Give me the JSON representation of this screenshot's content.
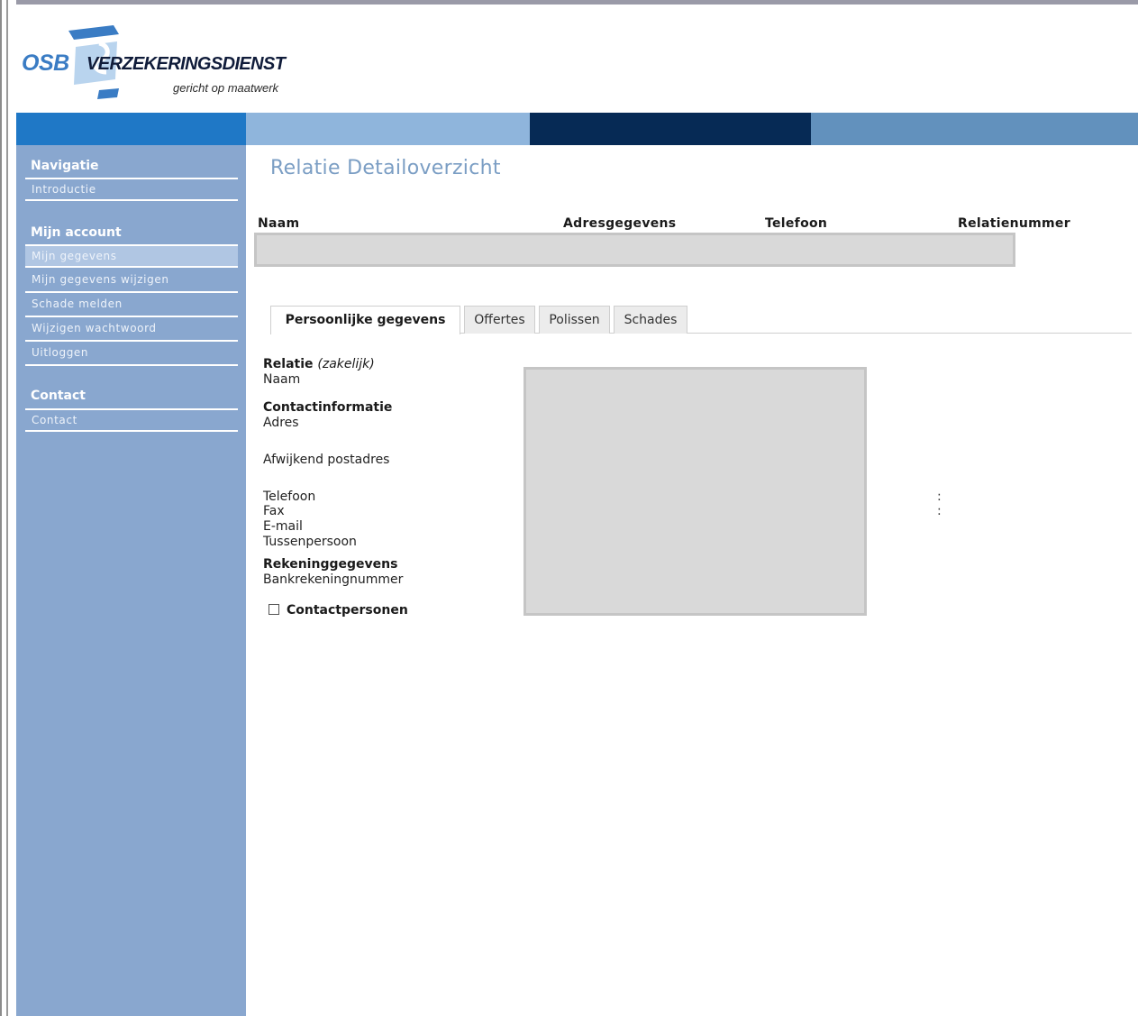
{
  "logo": {
    "osb": "OSB",
    "brand": "VERZEKERINGSDIENST",
    "tagline": "gericht op maatwerk"
  },
  "colors": {
    "band_blue": "#1f78c6",
    "band_light": "#8fb5dc",
    "band_navy": "#062a55",
    "band_mid": "#6291bd",
    "sidebar": "#89a7cf",
    "title": "#7b9ec4"
  },
  "sidebar": {
    "sections": [
      {
        "heading": "Navigatie",
        "items": [
          "Introductie"
        ]
      },
      {
        "heading": "Mijn account",
        "items": [
          "Mijn gegevens",
          "Mijn gegevens wijzigen",
          "Schade melden",
          "Wijzigen wachtwoord",
          "Uitloggen"
        ]
      },
      {
        "heading": "Contact",
        "items": [
          "Contact"
        ]
      }
    ],
    "active_item": "Mijn gegevens"
  },
  "main": {
    "title": "Relatie Detailoverzicht",
    "columns": [
      "Naam",
      "Adresgegevens",
      "Telefoon",
      "Relatienummer"
    ],
    "tabs": [
      {
        "label": "Persoonlijke gegevens",
        "active": true
      },
      {
        "label": "Offertes",
        "active": false
      },
      {
        "label": "Polissen",
        "active": false
      },
      {
        "label": "Schades",
        "active": false
      }
    ],
    "details": {
      "relatie_heading": "Relatie",
      "relatie_type": "(zakelijk)",
      "naam": "Naam",
      "contact_heading": "Contactinformatie",
      "adres": "Adres",
      "afwijkend_postadres": "Afwijkend postadres",
      "telefoon": "Telefoon",
      "fax": "Fax",
      "email": "E-mail",
      "tussenpersoon": "Tussenpersoon",
      "rekening_heading": "Rekeninggegevens",
      "bankrekeningnummer": "Bankrekeningnummer",
      "colon": ":"
    },
    "contactpersonen_label": "Contactpersonen",
    "contactpersonen_checked": false
  }
}
